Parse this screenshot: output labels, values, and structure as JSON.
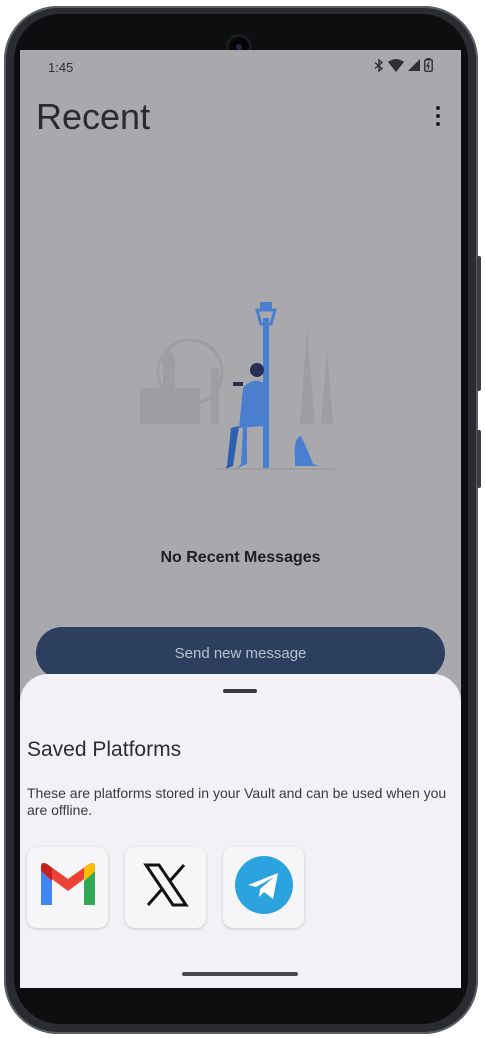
{
  "status_bar": {
    "time": "1:45",
    "icons": [
      "bluetooth-icon",
      "wifi-icon",
      "signal-icon",
      "battery-icon"
    ]
  },
  "app_bar": {
    "title": "Recent",
    "menu_icon": "more-vert-icon"
  },
  "empty_state": {
    "illustration": "person-leaning-on-lamppost-illustration",
    "title": "No Recent Messages"
  },
  "actions": {
    "send_new_message": "Send new message"
  },
  "bottom_sheet": {
    "title": "Saved Platforms",
    "description": "These are platforms stored in your Vault and can be used when you are offline.",
    "platforms": [
      {
        "name": "Gmail",
        "icon": "gmail-icon"
      },
      {
        "name": "X",
        "icon": "x-icon"
      },
      {
        "name": "Telegram",
        "icon": "telegram-icon"
      }
    ]
  },
  "colors": {
    "scrim_background": "#a9a9ad",
    "primary_button": "#2d3f5f",
    "sheet_background": "#f2f2f6",
    "telegram_blue": "#2aa3de",
    "illustration_blue": "#4a7fd0"
  }
}
